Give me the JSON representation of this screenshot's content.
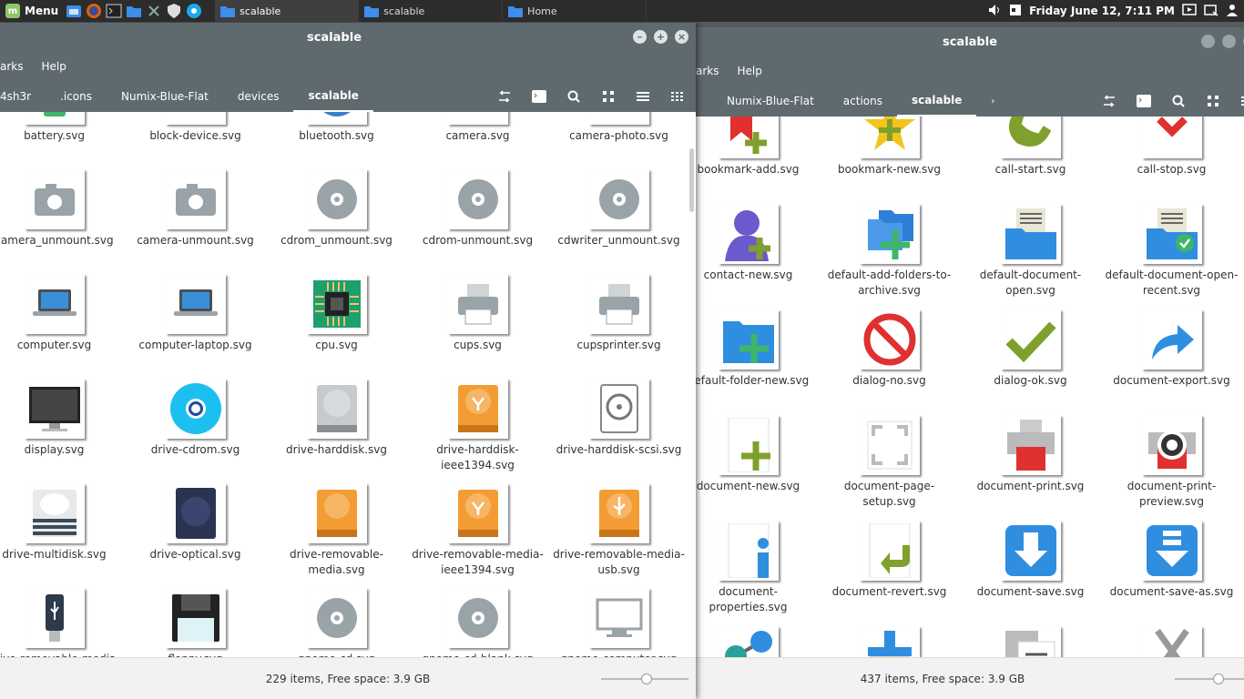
{
  "panel": {
    "menu_label": "Menu",
    "tasks": [
      {
        "label": "scalable",
        "active": true
      },
      {
        "label": "scalable",
        "active": false
      },
      {
        "label": "Home",
        "active": false
      }
    ],
    "clock": "Friday June 12,  7:11 PM"
  },
  "front": {
    "title": "scalable",
    "menu": [
      "arks",
      "Help"
    ],
    "crumbs": [
      "4sh3r",
      ".icons",
      "Numix-Blue-Flat",
      "devices",
      "scalable"
    ],
    "status": "229 items, Free space: 3.9 GB",
    "files": [
      {
        "name": "battery.svg",
        "icon": "battery-icon"
      },
      {
        "name": "block-device.svg",
        "icon": "block-device-icon"
      },
      {
        "name": "bluetooth.svg",
        "icon": "bluetooth-icon"
      },
      {
        "name": "camera.svg",
        "icon": "camera-icon"
      },
      {
        "name": "camera-photo.svg",
        "icon": "camera-photo-icon"
      },
      {
        "name": "camera_unmount.svg",
        "icon": "camera-icon"
      },
      {
        "name": "camera-unmount.svg",
        "icon": "camera-icon"
      },
      {
        "name": "cdrom_unmount.svg",
        "icon": "disc-icon"
      },
      {
        "name": "cdrom-unmount.svg",
        "icon": "disc-icon"
      },
      {
        "name": "cdwriter_unmount.svg",
        "icon": "disc-icon"
      },
      {
        "name": "computer.svg",
        "icon": "laptop-icon"
      },
      {
        "name": "computer-laptop.svg",
        "icon": "laptop-icon"
      },
      {
        "name": "cpu.svg",
        "icon": "cpu-icon"
      },
      {
        "name": "cups.svg",
        "icon": "printer-icon"
      },
      {
        "name": "cupsprinter.svg",
        "icon": "printer-icon"
      },
      {
        "name": "display.svg",
        "icon": "display-icon"
      },
      {
        "name": "drive-cdrom.svg",
        "icon": "cdrom-drive-icon"
      },
      {
        "name": "drive-harddisk.svg",
        "icon": "harddisk-icon"
      },
      {
        "name": "drive-harddisk-ieee1394.svg",
        "icon": "firewire-drive-icon"
      },
      {
        "name": "drive-harddisk-scsi.svg",
        "icon": "scsi-drive-icon"
      },
      {
        "name": "drive-multidisk.svg",
        "icon": "multidisk-icon"
      },
      {
        "name": "drive-optical.svg",
        "icon": "optical-drive-icon"
      },
      {
        "name": "drive-removable-media.svg",
        "icon": "removable-media-icon"
      },
      {
        "name": "drive-removable-media-ieee1394.svg",
        "icon": "firewire-drive-icon"
      },
      {
        "name": "drive-removable-media-usb.svg",
        "icon": "usb-drive-icon"
      },
      {
        "name": "drive-removable-media-usb-pendrive.svg",
        "icon": "usb-pendrive-icon"
      },
      {
        "name": "floppy.svg",
        "icon": "floppy-icon"
      },
      {
        "name": "gnome-cd.svg",
        "icon": "disc-icon"
      },
      {
        "name": "gnome-cd-blank.svg",
        "icon": "disc-icon"
      },
      {
        "name": "gnome-computer.svg",
        "icon": "monitor-icon"
      }
    ]
  },
  "back": {
    "title": "scalable",
    "menu": [
      "arks",
      "Help"
    ],
    "crumbs": [
      "Numix-Blue-Flat",
      "actions",
      "scalable"
    ],
    "status": "437 items, Free space: 3.9 GB",
    "files": [
      {
        "name": "bookmark-add.svg",
        "icon": "bookmark-icon"
      },
      {
        "name": "bookmark-new.svg",
        "icon": "star-icon"
      },
      {
        "name": "call-start.svg",
        "icon": "phone-icon"
      },
      {
        "name": "call-stop.svg",
        "icon": "call-stop-icon"
      },
      {
        "name": "contact-new.svg",
        "icon": "contact-icon"
      },
      {
        "name": "default-add-folders-to-archive.svg",
        "icon": "folders-add-icon"
      },
      {
        "name": "default-document-open.svg",
        "icon": "document-open-icon"
      },
      {
        "name": "default-document-open-recent.svg",
        "icon": "document-recent-icon"
      },
      {
        "name": "default-folder-new.svg",
        "icon": "folder-new-icon"
      },
      {
        "name": "dialog-no.svg",
        "icon": "no-icon"
      },
      {
        "name": "dialog-ok.svg",
        "icon": "check-icon"
      },
      {
        "name": "document-export.svg",
        "icon": "export-icon"
      },
      {
        "name": "document-new.svg",
        "icon": "document-new-icon"
      },
      {
        "name": "document-page-setup.svg",
        "icon": "page-setup-icon"
      },
      {
        "name": "document-print.svg",
        "icon": "print-icon"
      },
      {
        "name": "document-print-preview.svg",
        "icon": "print-preview-icon"
      },
      {
        "name": "document-properties.svg",
        "icon": "properties-icon"
      },
      {
        "name": "document-revert.svg",
        "icon": "revert-icon"
      },
      {
        "name": "document-save.svg",
        "icon": "save-icon"
      },
      {
        "name": "document-save-as.svg",
        "icon": "save-as-icon"
      },
      {
        "name": "",
        "icon": "share-icon"
      },
      {
        "name": "",
        "icon": "paste-icon"
      },
      {
        "name": "",
        "icon": "copy-icon"
      },
      {
        "name": "",
        "icon": "cut-icon"
      }
    ]
  }
}
